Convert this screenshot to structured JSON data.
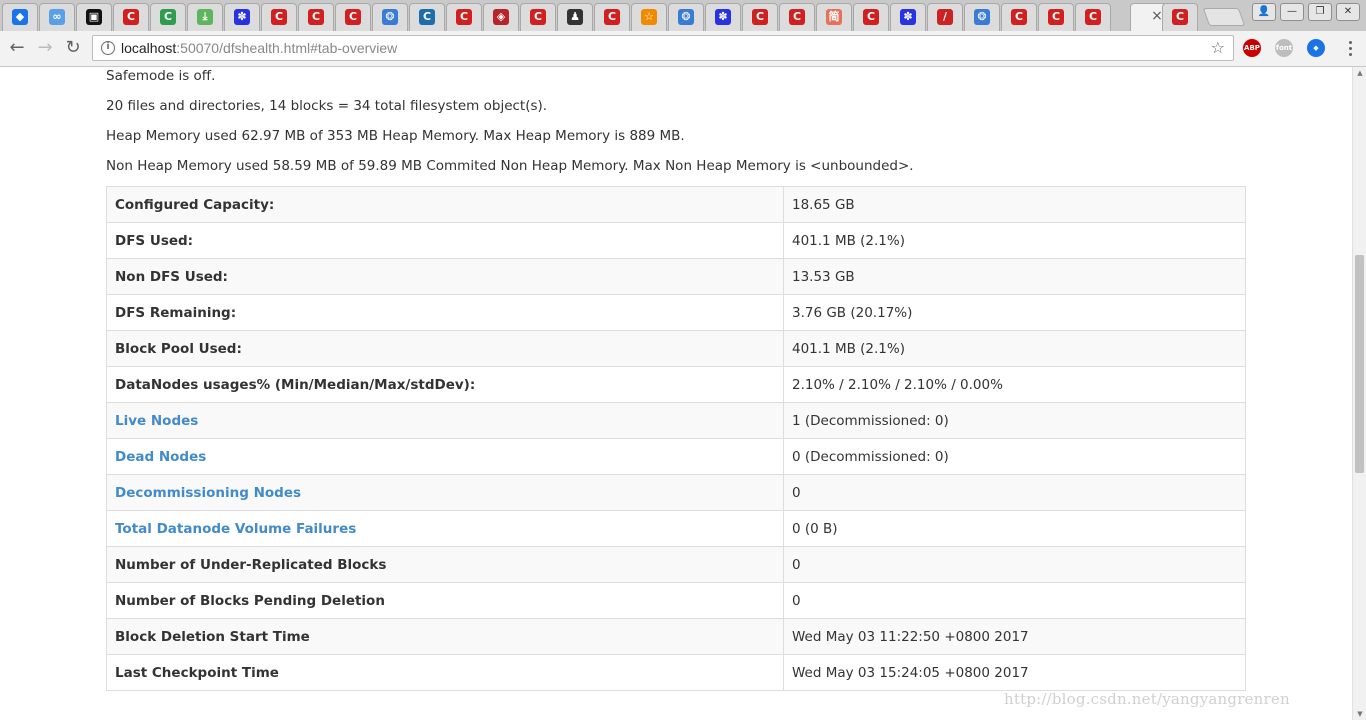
{
  "browser": {
    "tab_icons": [
      {
        "icon": "bookmark-blue-icon",
        "color": "#1a73e8",
        "glyph": "◆"
      },
      {
        "icon": "infinity-icon",
        "color": "#5aa0e8",
        "glyph": "∞"
      },
      {
        "icon": "terminal-icon",
        "color": "#111111",
        "glyph": "▣"
      },
      {
        "icon": "csdn-icon",
        "color": "#d02020",
        "glyph": "C"
      },
      {
        "icon": "green-circle-icon",
        "color": "#2e9e4e",
        "glyph": "C"
      },
      {
        "icon": "download-icon",
        "color": "#5db55d",
        "glyph": "⤓"
      },
      {
        "icon": "baidu-icon",
        "color": "#2932e1",
        "glyph": "✽"
      },
      {
        "icon": "csdn-icon",
        "color": "#d02020",
        "glyph": "C"
      },
      {
        "icon": "csdn-icon",
        "color": "#d02020",
        "glyph": "C"
      },
      {
        "icon": "csdn-icon",
        "color": "#d02020",
        "glyph": "C"
      },
      {
        "icon": "cloud-icon",
        "color": "#3a7bd5",
        "glyph": "❂"
      },
      {
        "icon": "c-blue-icon",
        "color": "#1b6eab",
        "glyph": "C"
      },
      {
        "icon": "csdn-icon",
        "color": "#d02020",
        "glyph": "C"
      },
      {
        "icon": "diamond-red-icon",
        "color": "#b8242c",
        "glyph": "◈"
      },
      {
        "icon": "csdn-icon",
        "color": "#d02020",
        "glyph": "C"
      },
      {
        "icon": "penguin-icon",
        "color": "#333333",
        "glyph": "♟"
      },
      {
        "icon": "csdn-icon",
        "color": "#d02020",
        "glyph": "C"
      },
      {
        "icon": "star-orange-icon",
        "color": "#f08a00",
        "glyph": "☆"
      },
      {
        "icon": "cloud-icon",
        "color": "#3a7bd5",
        "glyph": "❂"
      },
      {
        "icon": "baidu-icon",
        "color": "#2932e1",
        "glyph": "✽"
      },
      {
        "icon": "csdn-icon",
        "color": "#d02020",
        "glyph": "C"
      },
      {
        "icon": "csdn-icon",
        "color": "#d02020",
        "glyph": "C"
      },
      {
        "icon": "jianshu-icon",
        "color": "#ea6f5a",
        "glyph": "简"
      },
      {
        "icon": "csdn-icon",
        "color": "#d02020",
        "glyph": "C"
      },
      {
        "icon": "baidu-icon",
        "color": "#2932e1",
        "glyph": "✽"
      },
      {
        "icon": "pen-icon",
        "color": "#cc2222",
        "glyph": "/"
      },
      {
        "icon": "cloud-icon",
        "color": "#3a7bd5",
        "glyph": "❂"
      },
      {
        "icon": "csdn-icon",
        "color": "#d02020",
        "glyph": "C"
      },
      {
        "icon": "csdn-icon",
        "color": "#d02020",
        "glyph": "C"
      },
      {
        "icon": "csdn-icon",
        "color": "#d02020",
        "glyph": "C"
      }
    ],
    "active_tab_close": "×",
    "last_tab_icon": {
      "icon": "csdn-icon",
      "color": "#d02020",
      "glyph": "C"
    },
    "url_host": "localhost",
    "url_rest": ":50070/dfshealth.html#tab-overview",
    "extensions": [
      {
        "icon": "adblock-plus-icon",
        "label": "ABP",
        "color": "#c80000"
      },
      {
        "icon": "font-icon",
        "label": "font",
        "color": "#bdbdbd"
      },
      {
        "icon": "bookmark-blue-icon",
        "label": "◆",
        "color": "#1a73e8"
      }
    ]
  },
  "summary": {
    "safemode": "Safemode is off.",
    "objects": "20 files and directories, 14 blocks = 34 total filesystem object(s).",
    "heap": "Heap Memory used 62.97 MB of 353 MB Heap Memory. Max Heap Memory is 889 MB.",
    "nonheap": "Non Heap Memory used 58.59 MB of 59.89 MB Commited Non Heap Memory. Max Non Heap Memory is <unbounded>."
  },
  "rows": [
    {
      "label": "Configured Capacity:",
      "value": "18.65 GB",
      "link": false
    },
    {
      "label": "DFS Used:",
      "value": "401.1 MB (2.1%)",
      "link": false
    },
    {
      "label": "Non DFS Used:",
      "value": "13.53 GB",
      "link": false
    },
    {
      "label": "DFS Remaining:",
      "value": "3.76 GB (20.17%)",
      "link": false
    },
    {
      "label": "Block Pool Used:",
      "value": "401.1 MB (2.1%)",
      "link": false
    },
    {
      "label": "DataNodes usages% (Min/Median/Max/stdDev):",
      "value": "2.10% / 2.10% / 2.10% / 0.00%",
      "link": false
    },
    {
      "label": "Live Nodes",
      "value": "1 (Decommissioned: 0)",
      "link": true
    },
    {
      "label": "Dead Nodes",
      "value": "0 (Decommissioned: 0)",
      "link": true
    },
    {
      "label": "Decommissioning Nodes",
      "value": "0",
      "link": true
    },
    {
      "label": "Total Datanode Volume Failures",
      "value": "0 (0 B)",
      "link": true
    },
    {
      "label": "Number of Under-Replicated Blocks",
      "value": "0",
      "link": false
    },
    {
      "label": "Number of Blocks Pending Deletion",
      "value": "0",
      "link": false
    },
    {
      "label": "Block Deletion Start Time",
      "value": "Wed May 03 11:22:50 +0800 2017",
      "link": false
    },
    {
      "label": "Last Checkpoint Time",
      "value": "Wed May 03 15:24:05 +0800 2017",
      "link": false
    }
  ],
  "watermark": "http://blog.csdn.net/yangyangrenren"
}
